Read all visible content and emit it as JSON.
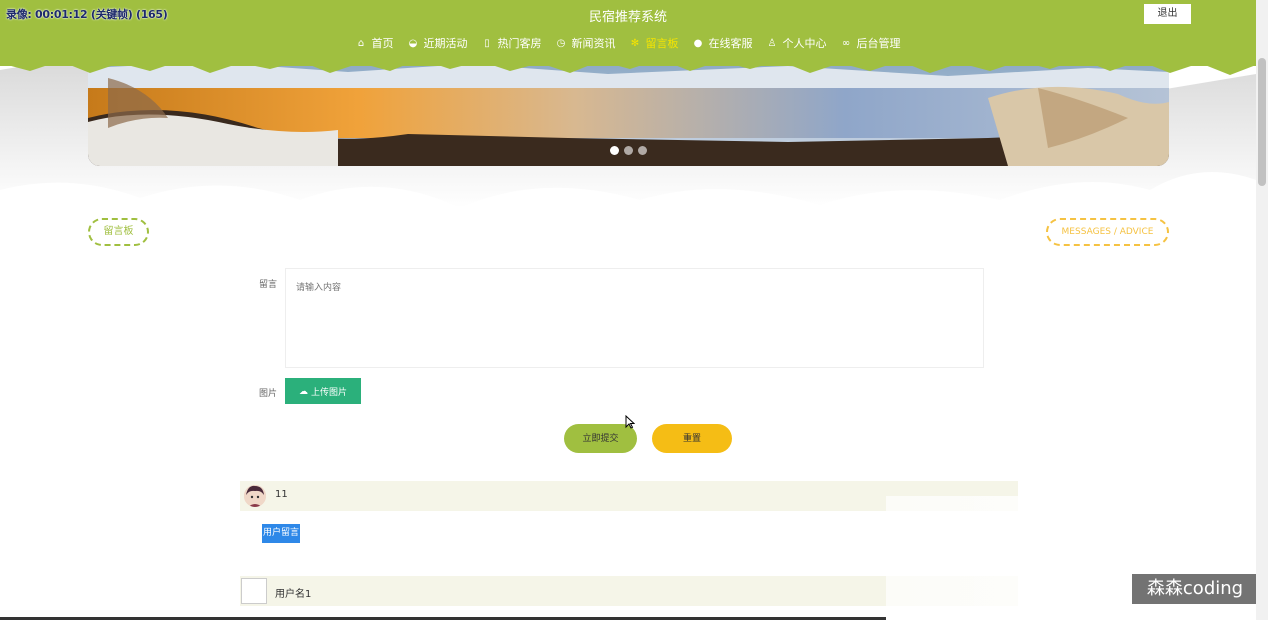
{
  "header": {
    "timer_text": "录像: 00:01:12 (关键帧) (165)",
    "site_title": "民宿推荐系统",
    "logout_label": "退出",
    "nav": [
      {
        "label": "首页",
        "icon": "home-icon",
        "active": false
      },
      {
        "label": "近期活动",
        "icon": "palette-icon",
        "active": false
      },
      {
        "label": "热门客房",
        "icon": "note-icon",
        "active": false
      },
      {
        "label": "新闻资讯",
        "icon": "clock-icon",
        "active": false
      },
      {
        "label": "留言板",
        "icon": "snowflake-icon",
        "active": true
      },
      {
        "label": "在线客服",
        "icon": "chat-icon",
        "active": false
      },
      {
        "label": "个人中心",
        "icon": "user-icon",
        "active": false
      },
      {
        "label": "后台管理",
        "icon": "link-icon",
        "active": false
      }
    ]
  },
  "section": {
    "title_left": "留言板",
    "title_right": "MESSAGES / ADVICE"
  },
  "form": {
    "message_label": "留言",
    "message_placeholder": "请输入内容",
    "image_label": "图片",
    "upload_label": "上传图片",
    "submit_label": "立即提交",
    "reset_label": "重置"
  },
  "messages": [
    {
      "username": "11",
      "content": "用户留言",
      "avatar": "avatar-image"
    },
    {
      "username": "用户名1",
      "avatar": "broken-image"
    }
  ],
  "watermark": "森森coding",
  "colors": {
    "primary": "#a0bf40",
    "accent": "#f5bd15",
    "active_nav": "#f5e400",
    "upload": "#2bb07b",
    "highlight": "#2e88e8"
  }
}
